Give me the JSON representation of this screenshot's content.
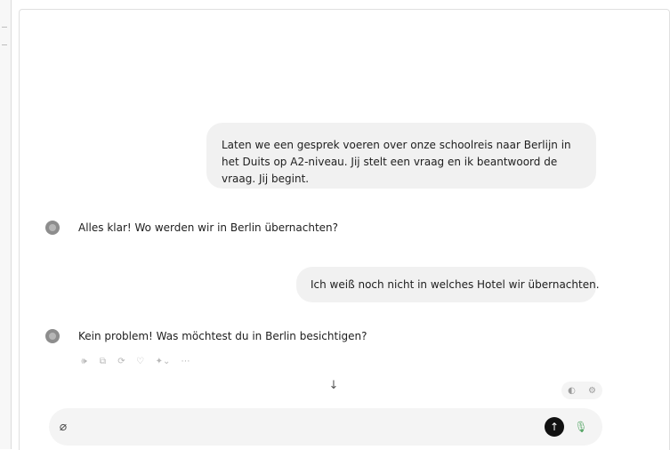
{
  "conversation": {
    "messages": [
      {
        "role": "user",
        "text": "Laten we een gesprek voeren over onze schoolreis naar Berlijn in het Duits op A2-niveau. Jij stelt een vraag en ik beantwoord de vraag. Jij begint."
      },
      {
        "role": "assistant",
        "text": "Alles klar! Wo werden wir in Berlin übernachten?"
      },
      {
        "role": "user",
        "text": "Ich weiß noch nicht in welches Hotel wir übernachten."
      },
      {
        "role": "assistant",
        "text": "Kein problem! Was möchtest du in Berlin besichtigen?"
      }
    ]
  },
  "message_actions": {
    "icons": [
      "speaker-icon",
      "copy-icon",
      "regenerate-icon",
      "thumbs-down-icon",
      "model-switch-icon",
      "more-icon"
    ],
    "glyphs": [
      "🕪",
      "⧉",
      "⟳",
      "♡",
      "✦⌄",
      "⋯"
    ]
  },
  "scroll_button": {
    "glyph": "↓"
  },
  "mini_controls": {
    "glyphs": [
      "◐",
      "⚙"
    ]
  },
  "composer": {
    "placeholder": "",
    "attach_glyph": "⌀",
    "send_glyph": "↑",
    "mic_glyph": "🎙"
  },
  "colors": {
    "user_bubble": "#f1f1f1",
    "composer_bg": "#f4f4f4",
    "send_button": "#111111",
    "mic_icon": "#5aa86a"
  }
}
